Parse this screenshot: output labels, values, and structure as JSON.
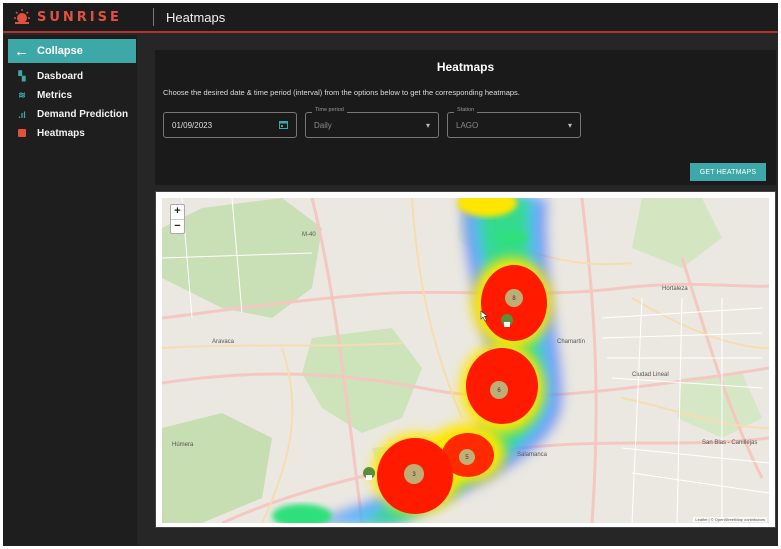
{
  "app": {
    "brand": "SUNRISE",
    "page_title": "Heatmaps"
  },
  "sidebar": {
    "collapse_label": "Collapse",
    "items": [
      {
        "label": "Dasboard",
        "icon": "dashboard-icon"
      },
      {
        "label": "Metrics",
        "icon": "metrics-icon"
      },
      {
        "label": "Demand Prediction",
        "icon": "bar-chart-icon"
      },
      {
        "label": "Heatmaps",
        "icon": "heatmap-icon"
      }
    ]
  },
  "heatmaps_form": {
    "title": "Heatmaps",
    "description": "Choose the desired date & time period (interval) from the options below to get the corresponding heatmaps.",
    "date_value": "01/09/2023",
    "time_period_label": "Time period",
    "time_period_value": "Daily",
    "station_label": "Station",
    "station_value": "LAGO",
    "get_button": "GET HEATMAPS"
  },
  "map": {
    "zoom_in": "+",
    "zoom_out": "−",
    "attribution": "Leaflet | © OpenStreetMap contributors",
    "place_labels": [
      "Aravaca",
      "Hortaleza",
      "Ciudad Lineal",
      "San Blas - Canillejas",
      "Húmera",
      "Chamartín",
      "Salamanca",
      "M-40"
    ],
    "clusters": [
      {
        "count": "8"
      },
      {
        "count": "6"
      },
      {
        "count": "5"
      },
      {
        "count": "3"
      }
    ],
    "colors": {
      "hot": "#ff1a00",
      "mid": "#ffe600",
      "cool": "#2ee07a",
      "cold": "#2a5cff"
    }
  }
}
